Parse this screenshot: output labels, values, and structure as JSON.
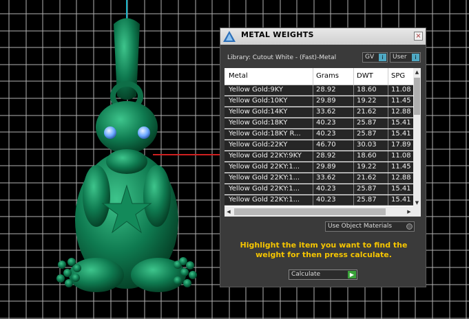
{
  "viewport": {
    "background": "#000000",
    "grid_color": "#d0d0d0",
    "model_color": "#0f7a50",
    "gem_color": "#6aa8ff"
  },
  "dialog": {
    "title": "METAL WEIGHTS",
    "close_label": "×",
    "library_label": "Library: Cutout White - (Fast)-Metal",
    "gv_label": "GV",
    "user_label": "User",
    "table": {
      "columns": [
        "Metal",
        "Grams",
        "DWT",
        "SPG"
      ],
      "rows": [
        [
          "Yellow Gold:9KY",
          "28.92",
          "18.60",
          "11.08"
        ],
        [
          "Yellow Gold:10KY",
          "29.89",
          "19.22",
          "11.45"
        ],
        [
          "Yellow Gold:14KY",
          "33.62",
          "21.62",
          "12.88"
        ],
        [
          "Yellow Gold:18KY",
          "40.23",
          "25.87",
          "15.41"
        ],
        [
          "Yellow Gold:18KY R...",
          "40.23",
          "25.87",
          "15.41"
        ],
        [
          "Yellow Gold:22KY",
          "46.70",
          "30.03",
          "17.89"
        ],
        [
          "Yellow Gold 22KY:9KY",
          "28.92",
          "18.60",
          "11.08"
        ],
        [
          "Yellow Gold 22KY:1...",
          "29.89",
          "19.22",
          "11.45"
        ],
        [
          "Yellow Gold 22KY:1...",
          "33.62",
          "21.62",
          "12.88"
        ],
        [
          "Yellow Gold 22KY:1...",
          "40.23",
          "25.87",
          "15.41"
        ],
        [
          "Yellow Gold 22KY:1...",
          "40.23",
          "25.87",
          "15.41"
        ]
      ]
    },
    "use_object_materials_label": "Use Object Materials",
    "hint": "Highlight the item you want to find the weight for then press calculate.",
    "calculate_label": "Calculate",
    "hint_color": "#f7c600"
  }
}
